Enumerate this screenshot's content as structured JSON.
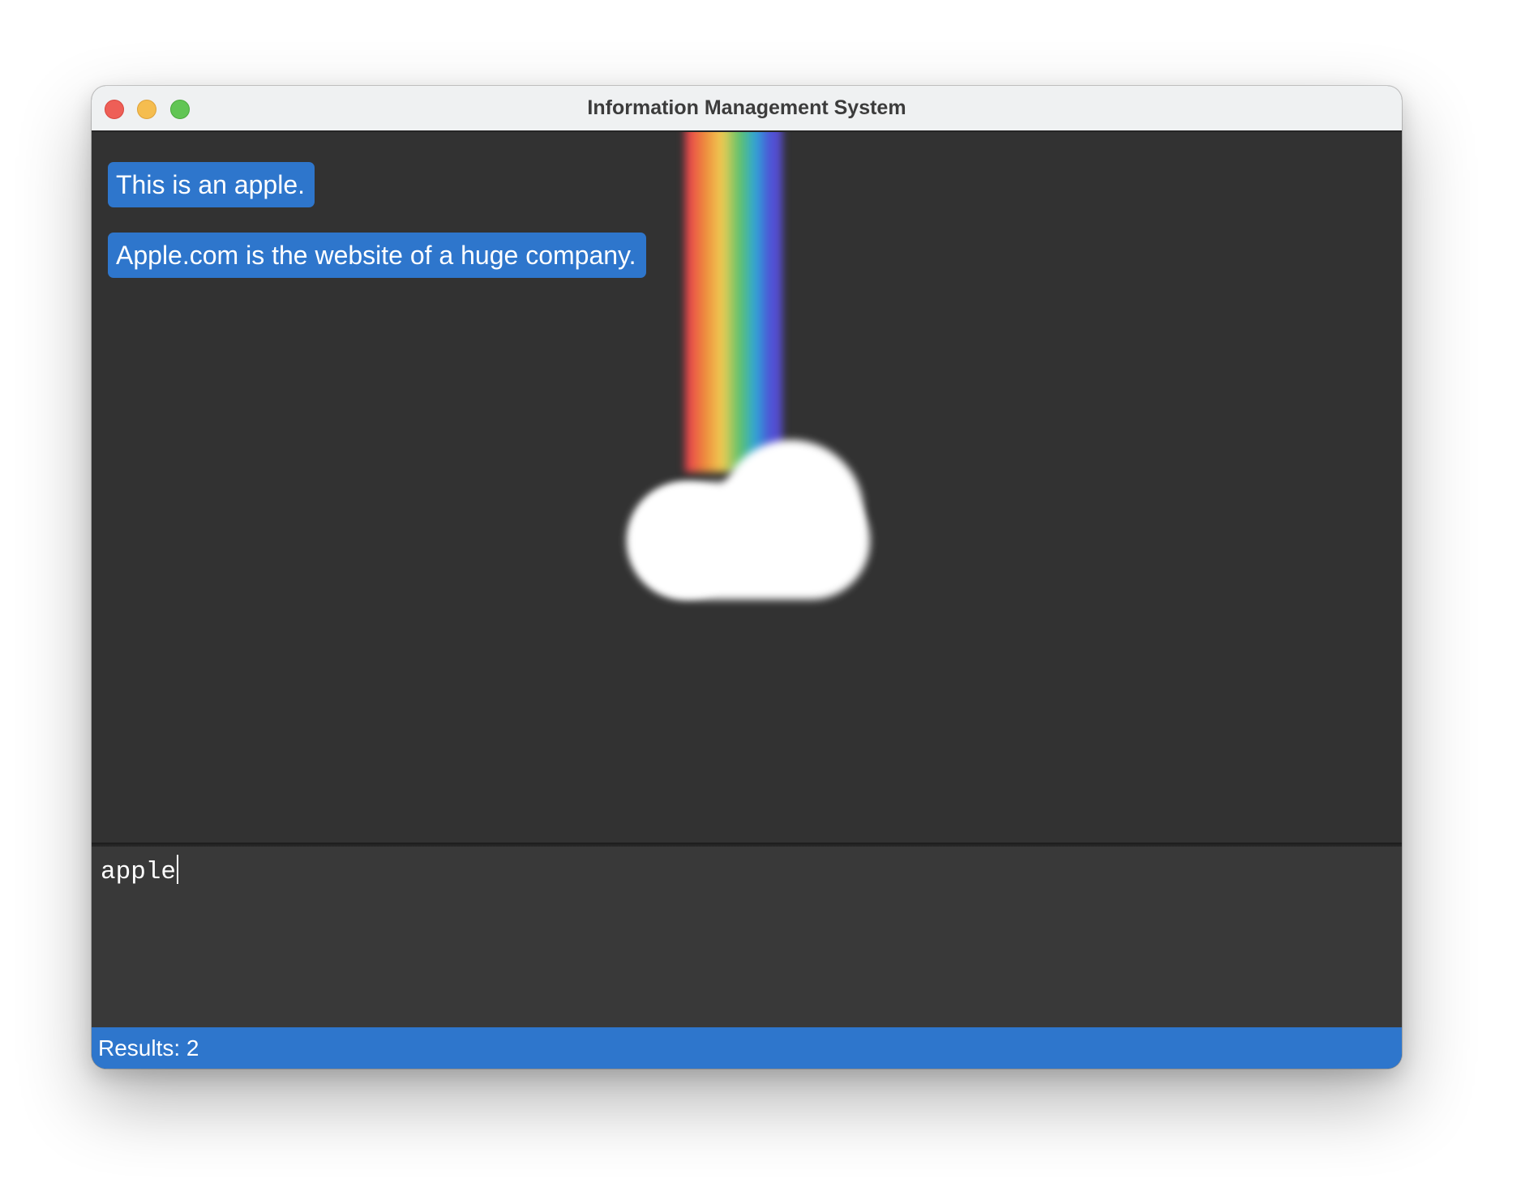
{
  "window": {
    "title": "Information Management System"
  },
  "results": {
    "items": [
      {
        "text": "This is an apple."
      },
      {
        "text": "Apple.com is the website of a huge company."
      }
    ]
  },
  "search": {
    "query": "apple"
  },
  "status": {
    "text": "Results: 2"
  },
  "colors": {
    "accent": "#2e76cc",
    "content_background": "#323232",
    "input_background": "#393939",
    "titlebar": "#eff1f2"
  },
  "icons": [
    "close-window-button",
    "minimize-window-button",
    "zoom-window-button",
    "rainbow-cloud-illustration"
  ]
}
